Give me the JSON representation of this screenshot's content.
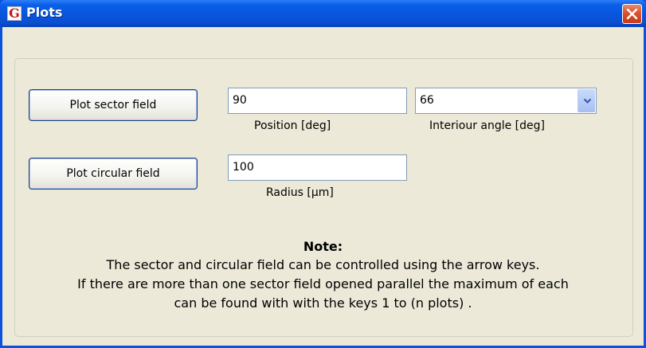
{
  "window": {
    "title": "Plots",
    "app_icon_letter": "G"
  },
  "controls": {
    "plot_sector_button": "Plot sector field",
    "plot_circular_button": "Plot circular field",
    "position_value": "90",
    "position_label": "Position [deg]",
    "interior_angle_value": "66",
    "interior_angle_label": "Interiour angle [deg]",
    "radius_value": "100",
    "radius_label": "Radius  [µm]"
  },
  "note": {
    "title": "Note:",
    "lines": [
      "The sector and circular field can be controlled using the arrow keys.",
      "If there are more than one sector field opened parallel the maximum of each",
      "can be found with with the keys 1 to (n plots) ."
    ]
  },
  "icons": {
    "close": "close-icon",
    "dropdown": "chevron-down-icon",
    "app": "app-icon"
  },
  "colors": {
    "titlebar": "#0855dd",
    "dialog_background": "#ece9d8",
    "close_button": "#d9532e"
  }
}
